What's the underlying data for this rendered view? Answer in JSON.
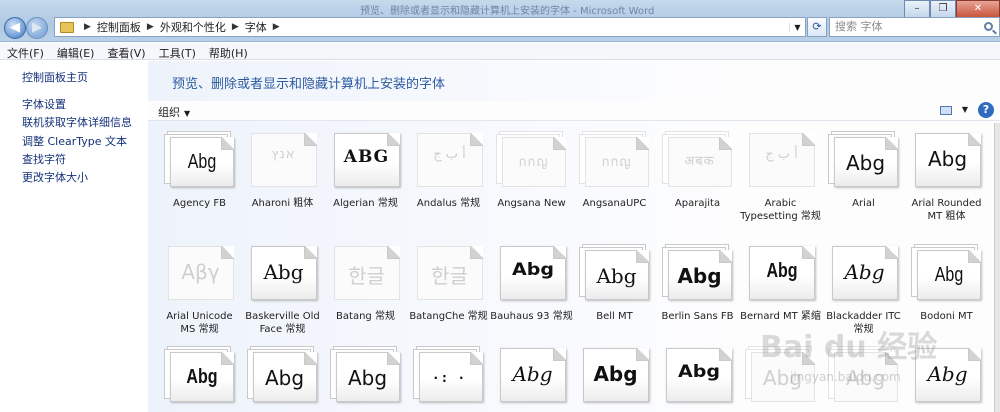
{
  "window": {
    "title": "预览、删除或者显示和隐藏计算机上安装的字体 - Microsoft Word"
  },
  "address": {
    "crumbs": [
      "控制面板",
      "外观和个性化",
      "字体"
    ],
    "search_placeholder": "搜索 字体"
  },
  "menu": [
    "文件(F)",
    "编辑(E)",
    "查看(V)",
    "工具(T)",
    "帮助(H)"
  ],
  "left_pane": {
    "home": "控制面板主页",
    "links": [
      "字体设置",
      "联机获取字体详细信息",
      "调整 ClearType 文本",
      "查找字符",
      "更改字体大小"
    ]
  },
  "main": {
    "heading": "预览、删除或者显示和隐藏计算机上安装的字体",
    "organize": "组织"
  },
  "fonts": [
    {
      "sample": "Abg",
      "name": "Agency FB",
      "hidden": false,
      "stacked": true
    },
    {
      "sample": "אנץ",
      "name": "Aharoni 粗体",
      "hidden": true,
      "stacked": false
    },
    {
      "sample": "ABG",
      "name": "Algerian 常规",
      "hidden": false,
      "stacked": false
    },
    {
      "sample": "أ ب ج",
      "name": "Andalus 常规",
      "hidden": true,
      "stacked": false
    },
    {
      "sample": "กกญ",
      "name": "Angsana New",
      "hidden": true,
      "stacked": true
    },
    {
      "sample": "กกญ",
      "name": "AngsanaUPC",
      "hidden": true,
      "stacked": true
    },
    {
      "sample": "अबक",
      "name": "Aparajita",
      "hidden": true,
      "stacked": true
    },
    {
      "sample": "أ ب ج",
      "name": "Arabic Typesetting 常规",
      "hidden": true,
      "stacked": false
    },
    {
      "sample": "Abg",
      "name": "Arial",
      "hidden": false,
      "stacked": true
    },
    {
      "sample": "Abg",
      "name": "Arial Rounded MT 粗体",
      "hidden": false,
      "stacked": false
    },
    {
      "sample": "Αβγ",
      "name": "Arial Unicode MS 常规",
      "hidden": true,
      "stacked": false
    },
    {
      "sample": "Abg",
      "name": "Baskerville Old Face 常规",
      "hidden": false,
      "stacked": false
    },
    {
      "sample": "한글",
      "name": "Batang 常规",
      "hidden": true,
      "stacked": false
    },
    {
      "sample": "한글",
      "name": "BatangChe 常规",
      "hidden": true,
      "stacked": false
    },
    {
      "sample": "Abg",
      "name": "Bauhaus 93 常规",
      "hidden": false,
      "stacked": false
    },
    {
      "sample": "Abg",
      "name": "Bell MT",
      "hidden": false,
      "stacked": true
    },
    {
      "sample": "Abg",
      "name": "Berlin Sans FB",
      "hidden": false,
      "stacked": true
    },
    {
      "sample": "Abg",
      "name": "Bernard MT 紧缩",
      "hidden": false,
      "stacked": false
    },
    {
      "sample": "Abg",
      "name": "Blackadder ITC 常规",
      "hidden": false,
      "stacked": false
    },
    {
      "sample": "Abg",
      "name": "Bodoni MT",
      "hidden": false,
      "stacked": true
    },
    {
      "sample": "Abg",
      "name": "",
      "hidden": false,
      "stacked": true
    },
    {
      "sample": "Abg",
      "name": "",
      "hidden": false,
      "stacked": true
    },
    {
      "sample": "Abg",
      "name": "",
      "hidden": false,
      "stacked": true
    },
    {
      "sample": "·: ·",
      "name": "",
      "hidden": false,
      "stacked": true
    },
    {
      "sample": "Abg",
      "name": "",
      "hidden": false,
      "stacked": false
    },
    {
      "sample": "Abg",
      "name": "",
      "hidden": false,
      "stacked": false
    },
    {
      "sample": "Abg",
      "name": "",
      "hidden": false,
      "stacked": false
    },
    {
      "sample": "Abg",
      "name": "",
      "hidden": true,
      "stacked": true
    },
    {
      "sample": "Abg",
      "name": "",
      "hidden": true,
      "stacked": true
    },
    {
      "sample": "Abg",
      "name": "",
      "hidden": false,
      "stacked": false
    }
  ],
  "watermark": {
    "brand": "Bai du 经验",
    "url": "jingyan.baidu.com"
  }
}
